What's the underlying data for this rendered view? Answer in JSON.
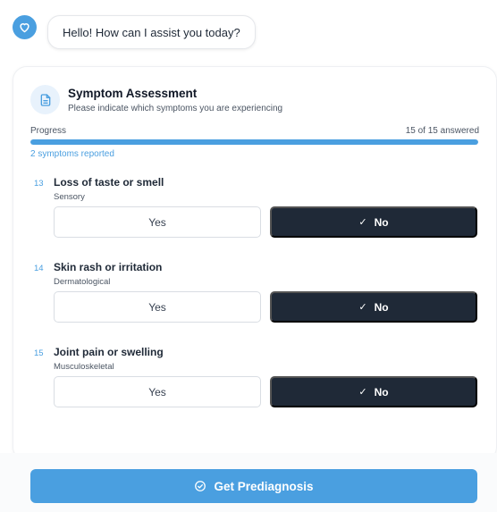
{
  "chat": {
    "greeting": "Hello! How can I assist you today?",
    "avatar_icon": "heart-icon"
  },
  "assessment": {
    "icon": "document-icon",
    "title": "Symptom Assessment",
    "subtitle": "Please indicate which symptoms you are experiencing",
    "progress_label": "Progress",
    "progress_count": "15 of 15 answered",
    "progress_fraction": 1.0,
    "reported_summary": "2 symptoms reported",
    "questions": [
      {
        "number": "13",
        "title": "Loss of taste or smell",
        "category": "Sensory",
        "yes_label": "Yes",
        "no_label": "No",
        "selected": "No"
      },
      {
        "number": "14",
        "title": "Skin rash or irritation",
        "category": "Dermatological",
        "yes_label": "Yes",
        "no_label": "No",
        "selected": "No"
      },
      {
        "number": "15",
        "title": "Joint pain or swelling",
        "category": "Musculoskeletal",
        "yes_label": "Yes",
        "no_label": "No",
        "selected": "No"
      }
    ]
  },
  "footer": {
    "cta_label": "Get Prediagnosis",
    "cta_icon": "check-circle-icon"
  },
  "colors": {
    "accent": "#4a9fe0",
    "selected_button": "#1f2937"
  }
}
